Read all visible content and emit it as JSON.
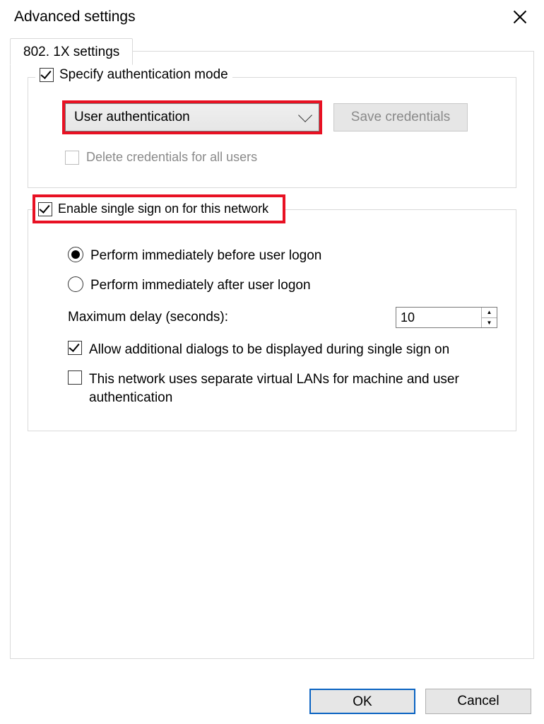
{
  "window": {
    "title": "Advanced settings"
  },
  "tabs": {
    "settings": "802. 1X settings"
  },
  "group_auth": {
    "legend": "Specify authentication mode",
    "mode_selected": "User authentication",
    "save_credentials": "Save credentials",
    "delete_all": "Delete credentials for all users"
  },
  "group_sso": {
    "legend": "Enable single sign on for this network",
    "before": "Perform immediately before user logon",
    "after": "Perform immediately after user logon",
    "delay_label": "Maximum delay (seconds):",
    "delay_value": "10",
    "allow_dialogs": "Allow additional dialogs to be displayed during single sign on",
    "separate_vlan": "This network uses separate virtual LANs for machine and user authentication"
  },
  "footer": {
    "ok": "OK",
    "cancel": "Cancel"
  }
}
